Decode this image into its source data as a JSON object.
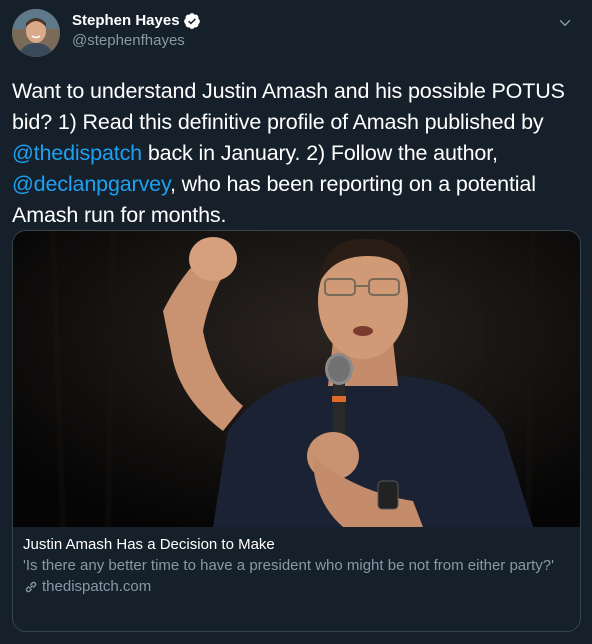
{
  "author": {
    "display_name": "Stephen Hayes",
    "handle": "@stephenfhayes",
    "verified": true
  },
  "tweet": {
    "text_part1": "Want to understand Justin Amash and his possible POTUS bid? 1) Read this definitive profile of Amash published by ",
    "mention1": "@thedispatch",
    "text_part2": " back in January. 2) Follow the author, ",
    "mention2": "@declanpgarvey",
    "text_part3": ", who has been reporting on a potential Amash run for months."
  },
  "card": {
    "title": "Justin Amash Has a Decision to Make",
    "description": "'Is there any better time to have a president who might be not from either party?'",
    "domain": "thedispatch.com"
  },
  "icons": {
    "verified": "verified-badge-icon",
    "more": "chevron-down-icon",
    "link": "link-icon"
  },
  "colors": {
    "background": "#15202b",
    "accent": "#1da1f2",
    "secondary_text": "#8899a6",
    "border": "#38444d"
  }
}
